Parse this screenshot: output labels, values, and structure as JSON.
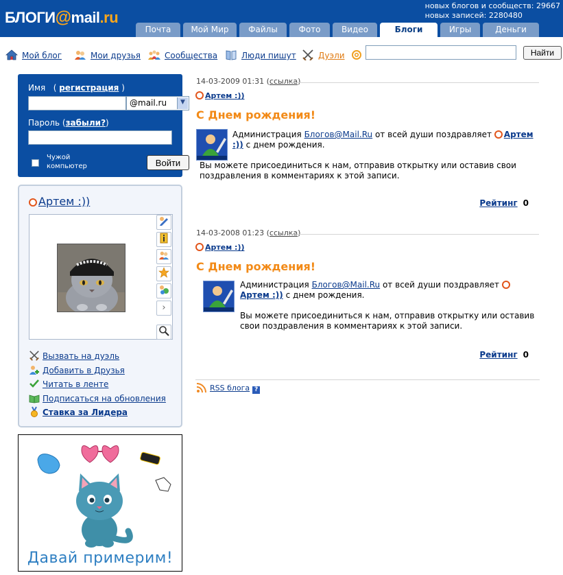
{
  "logo": {
    "main": "БЛОГИ",
    "at": "@",
    "mail": "mail",
    "ru": ".ru"
  },
  "stats": {
    "blogs_label": "новых блогов и сообществ:",
    "blogs_value": "29667",
    "posts_label": "новых записей:",
    "posts_value": "2280480"
  },
  "tabs": [
    {
      "label": "Почта",
      "active": false
    },
    {
      "label": "Мой Мир",
      "active": false
    },
    {
      "label": "Файлы",
      "active": false
    },
    {
      "label": "Фото",
      "active": false
    },
    {
      "label": "Видео",
      "active": false
    },
    {
      "label": "Блоги",
      "active": true
    },
    {
      "label": "Игры",
      "active": false
    },
    {
      "label": "Деньги",
      "active": false
    }
  ],
  "quicknav": {
    "my_blog": "Мой блог",
    "my_friends": "Мои друзья",
    "communities": "Сообщества",
    "people_write": "Люди пишут",
    "duels": "Дуэли",
    "search_value": "",
    "search_button": "Найти"
  },
  "login": {
    "name_label": "Имя",
    "register_link": "регистрация",
    "domain": "@mail.ru",
    "password_label": "Пароль",
    "forgot_link": "забыли?",
    "foreign_computer": "Чужой компьютер",
    "login_button": "Войти"
  },
  "profile": {
    "name": "Артем :))",
    "links": {
      "duel": "Вызвать на дуэль",
      "add_friend": "Добавить в Друзья",
      "read_feed": "Читать в ленте",
      "subscribe": "Подписаться на обновления",
      "bet_leader": "Ставка за Лидера"
    }
  },
  "ad": {
    "text": "Давай примерим!"
  },
  "posts": [
    {
      "date": "14-03-2009 01:31",
      "link": "ссылка",
      "author": "Артем :))",
      "title": "С Днем рождения!",
      "text_admin": "Администрация",
      "text_blogs_link": "Блогов@Mail.Ru",
      "text_middle": "от всей души поздравляет",
      "text_user": "Артем :))",
      "text_end": "с днем рождения.",
      "text_join": "Вы можете присоединиться к нам, отправив открытку или оставив свои поздравления в комментариях к этой записи.",
      "rating_label": "Рейтинг",
      "rating_value": "0"
    },
    {
      "date": "14-03-2008 01:23",
      "link": "ссылка",
      "author": "Артем :))",
      "title": "С Днем рождения!",
      "text_admin": "Администрация",
      "text_blogs_link": "Блогов@Mail.Ru",
      "text_middle": "от всей души поздравляет",
      "text_user": "Артем :))",
      "text_end": "с днем рождения.",
      "text_join": "Вы можете присоединиться к нам, отправив открытку или оставив свои поздравления в комментариях к этой записи.",
      "rating_label": "Рейтинг",
      "rating_value": "0"
    }
  ],
  "rss": {
    "label": "RSS блога",
    "help": "?"
  },
  "colors": {
    "brand_blue": "#0b4ea2",
    "accent_orange": "#f28a17",
    "link": "#0a3a8c"
  }
}
